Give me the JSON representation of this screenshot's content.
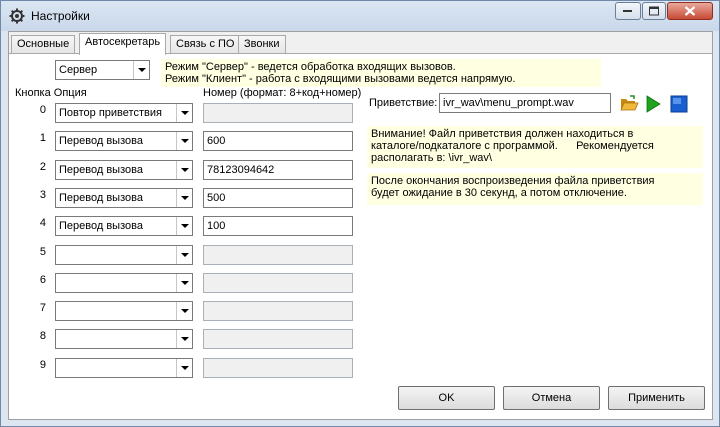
{
  "window": {
    "title": "Настройки"
  },
  "tabs": [
    {
      "label": "Основные"
    },
    {
      "label": "Автосекретарь"
    },
    {
      "label": "Связь с ПО"
    },
    {
      "label": "Звонки"
    }
  ],
  "mode": {
    "value": "Сервер",
    "note_line1": "Режим \"Сервер\" - ведется обработка входящих вызовов.",
    "note_line2": "Режим \"Клиент\" - работа с входящими вызовами ведется напрямую."
  },
  "headers": {
    "key_option": "Кнопка Опция",
    "number": "Номер (формат: 8+код+номер)"
  },
  "rows": [
    {
      "key": "0",
      "option": "Повтор приветствия",
      "number": ""
    },
    {
      "key": "1",
      "option": "Перевод вызова",
      "number": "600"
    },
    {
      "key": "2",
      "option": "Перевод вызова",
      "number": "78123094642"
    },
    {
      "key": "3",
      "option": "Перевод вызова",
      "number": "500"
    },
    {
      "key": "4",
      "option": "Перевод вызова",
      "number": "100"
    },
    {
      "key": "5",
      "option": "",
      "number": ""
    },
    {
      "key": "6",
      "option": "",
      "number": ""
    },
    {
      "key": "7",
      "option": "",
      "number": ""
    },
    {
      "key": "8",
      "option": "",
      "number": ""
    },
    {
      "key": "9",
      "option": "",
      "number": ""
    }
  ],
  "greeting": {
    "label": "Приветствие:",
    "value": "ivr_wav\\menu_prompt.wav",
    "note1_line1": "Внимание! Файл приветствия должен находиться в",
    "note1_line2": "каталоге/подкаталоге с программой.      Рекомендуется",
    "note1_line3": "располагать в: \\ivr_wav\\",
    "note2_line1": "После окончания воспроизведения файла приветствия",
    "note2_line2": "будет ожидание в 30 секунд, а потом отключение.",
    "icons": [
      "folder-open-icon",
      "play-icon",
      "stop-icon"
    ],
    "colors": {
      "play": "#1fa31f",
      "stop": "#1a5fd0",
      "folder": "#e0a526"
    }
  },
  "buttons": {
    "ok": "OK",
    "cancel": "Отмена",
    "apply": "Применить"
  }
}
